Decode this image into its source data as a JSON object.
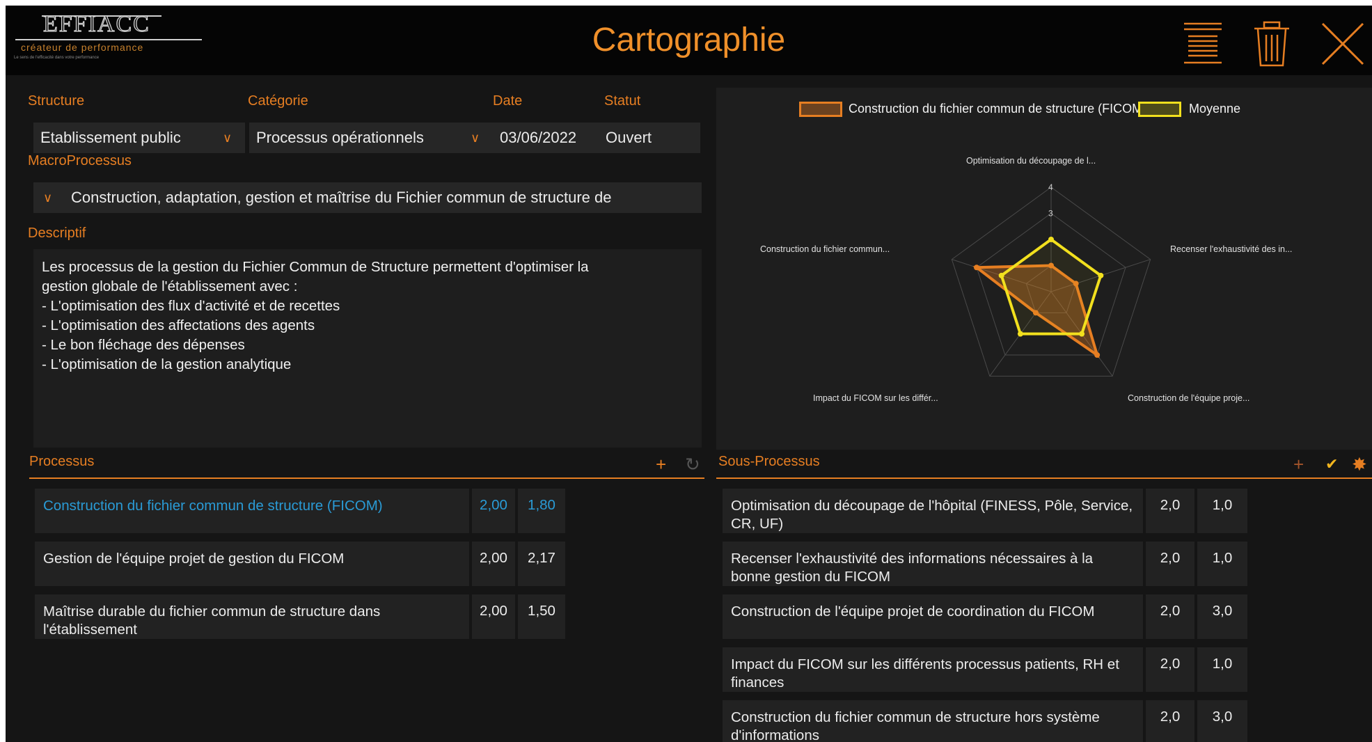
{
  "header": {
    "title": "Cartographie",
    "logo": {
      "name": "EFFIACC",
      "tagline": "créateur de performance",
      "small_text": "Le sens de l'efficacité dans votre performance"
    },
    "colors": {
      "accent": "#e67e22",
      "background": "#050505"
    }
  },
  "form": {
    "structure": {
      "label": "Structure",
      "value": "Etablissement public"
    },
    "categorie": {
      "label": "Catégorie",
      "value": "Processus opérationnels"
    },
    "date": {
      "label": "Date",
      "value": "03/06/2022"
    },
    "statut": {
      "label": "Statut",
      "value": "Ouvert"
    },
    "macroprocessus": {
      "label": "MacroProcessus",
      "value": "Construction, adaptation, gestion et maîtrise du Fichier commun de structure de"
    },
    "descriptif": {
      "label": "Descriptif",
      "text": "Les processus de la gestion du Fichier Commun de Structure permettent d'optimiser la\ngestion globale de l'établissement avec :\n- L'optimisation des flux d'activité et de recettes\n- L'optimisation des affectations des agents\n- Le bon fléchage des dépenses\n- L'optimisation de la gestion analytique"
    }
  },
  "chart_data": {
    "type": "radar",
    "axes": [
      "Optimisation du découpage de l...",
      "Recenser l'exhaustivité des in...",
      "Construction de l'équipe proje...",
      "Impact du FICOM sur les différ...",
      "Construction du fichier commun..."
    ],
    "tick_labels": [
      "3",
      "4"
    ],
    "range": [
      0,
      4
    ],
    "series": [
      {
        "name": "Construction du fichier commun de structure (FICOM)",
        "color": "#e67e22",
        "values": [
          1,
          1,
          3,
          1,
          3
        ]
      },
      {
        "name": "Moyenne",
        "color": "#f2e01e",
        "values": [
          2,
          2,
          2,
          2,
          2
        ]
      }
    ],
    "legend": "top"
  },
  "processus": {
    "title": "Processus",
    "rows": [
      {
        "name": "Construction du fichier commun de structure (FICOM)",
        "v1": "2,00",
        "v2": "1,80",
        "selected": true
      },
      {
        "name": "Gestion de l'équipe projet de gestion du FICOM",
        "v1": "2,00",
        "v2": "2,17",
        "selected": false
      },
      {
        "name": "Maîtrise durable du fichier commun de structure dans l'établissement",
        "v1": "2,00",
        "v2": "1,50",
        "selected": false
      }
    ]
  },
  "sous_processus": {
    "title": "Sous-Processus",
    "rows": [
      {
        "name": "Optimisation du découpage de l'hôpital (FINESS, Pôle, Service, CR, UF)",
        "v1": "2,0",
        "v2": "1,0"
      },
      {
        "name": "Recenser l'exhaustivité des informations nécessaires à la bonne gestion du FICOM",
        "v1": "2,0",
        "v2": "1,0"
      },
      {
        "name": "Construction de l'équipe projet de coordination du FICOM",
        "v1": "2,0",
        "v2": "3,0"
      },
      {
        "name": "Impact du FICOM sur les différents processus patients, RH et finances",
        "v1": "2,0",
        "v2": "1,0"
      },
      {
        "name": "Construction du fichier commun de structure hors système d'informations",
        "v1": "2,0",
        "v2": "3,0"
      }
    ]
  },
  "icons": {
    "menu": "menu-icon",
    "delete": "trash-icon",
    "close": "close-icon",
    "add": "plus-icon",
    "refresh": "refresh-icon",
    "validate": "check-icon",
    "settings": "network-icon",
    "dropdown": "chevron-down-icon"
  }
}
